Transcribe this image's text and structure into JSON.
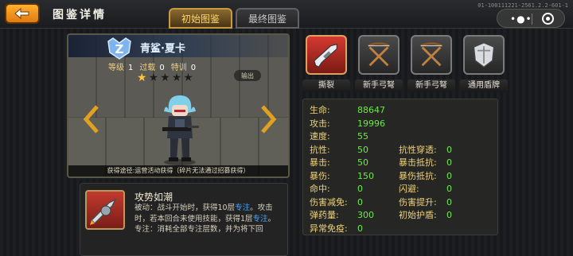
{
  "topbar": {
    "title": "图鉴详情",
    "tabs": [
      "初始图鉴",
      "最终图鉴"
    ],
    "version": "01-100111221-2561.2.2-601-1"
  },
  "character": {
    "name": "青鲨·夏卡",
    "rank_letter": "Z",
    "level_label": "等级",
    "level": "1",
    "breakthrough_label": "过载",
    "breakthrough": "0",
    "training_label": "特训",
    "training": "0",
    "stars_total": 5,
    "stars_filled": 1,
    "output_tag": "输出",
    "obtain": "获得途径:运营活动获得（碎片无法通过招募获得）"
  },
  "skill": {
    "name": "攻势如潮",
    "desc_1": "被动：战斗开始时，获得10层",
    "desc_hl_1": "专注",
    "desc_2": "。攻击时，若本回合未使用技能，获得1层",
    "desc_hl_2": "专注",
    "desc_3": "。",
    "desc_4": "专注：消耗全部专注层数，并为将下回"
  },
  "equipment": [
    {
      "label": "撕裂",
      "icon": "rifle-icon",
      "highlight": true
    },
    {
      "label": "新手弓弩",
      "icon": "crossbow-icon",
      "highlight": false
    },
    {
      "label": "新手弓弩",
      "icon": "crossbow-icon",
      "highlight": false
    },
    {
      "label": "通用盾牌",
      "icon": "shield-icon",
      "highlight": false
    }
  ],
  "stats_left": [
    {
      "label": "生命:",
      "value": "88647"
    },
    {
      "label": "攻击:",
      "value": "19996"
    },
    {
      "label": "速度:",
      "value": "55"
    },
    {
      "label": "抗性:",
      "value": "50"
    },
    {
      "label": "暴击:",
      "value": "50"
    },
    {
      "label": "暴伤:",
      "value": "150"
    },
    {
      "label": "命中:",
      "value": "0"
    },
    {
      "label": "伤害减免:",
      "value": "0"
    },
    {
      "label": "弹药量:",
      "value": "300"
    },
    {
      "label": "异常免疫:",
      "value": "0"
    }
  ],
  "stats_right": [
    {
      "label": "抗性穿透:",
      "value": "0"
    },
    {
      "label": "暴击抵抗:",
      "value": "0"
    },
    {
      "label": "暴伤抵抗:",
      "value": "0"
    },
    {
      "label": "闪避:",
      "value": "0"
    },
    {
      "label": "伤害提升:",
      "value": "0"
    },
    {
      "label": "初始护盾:",
      "value": "0"
    }
  ],
  "colors": {
    "accent": "#f0a020",
    "stat_label": "#f0d27a",
    "stat_value": "#6ee84a",
    "highlight_text": "#49a7ff"
  }
}
